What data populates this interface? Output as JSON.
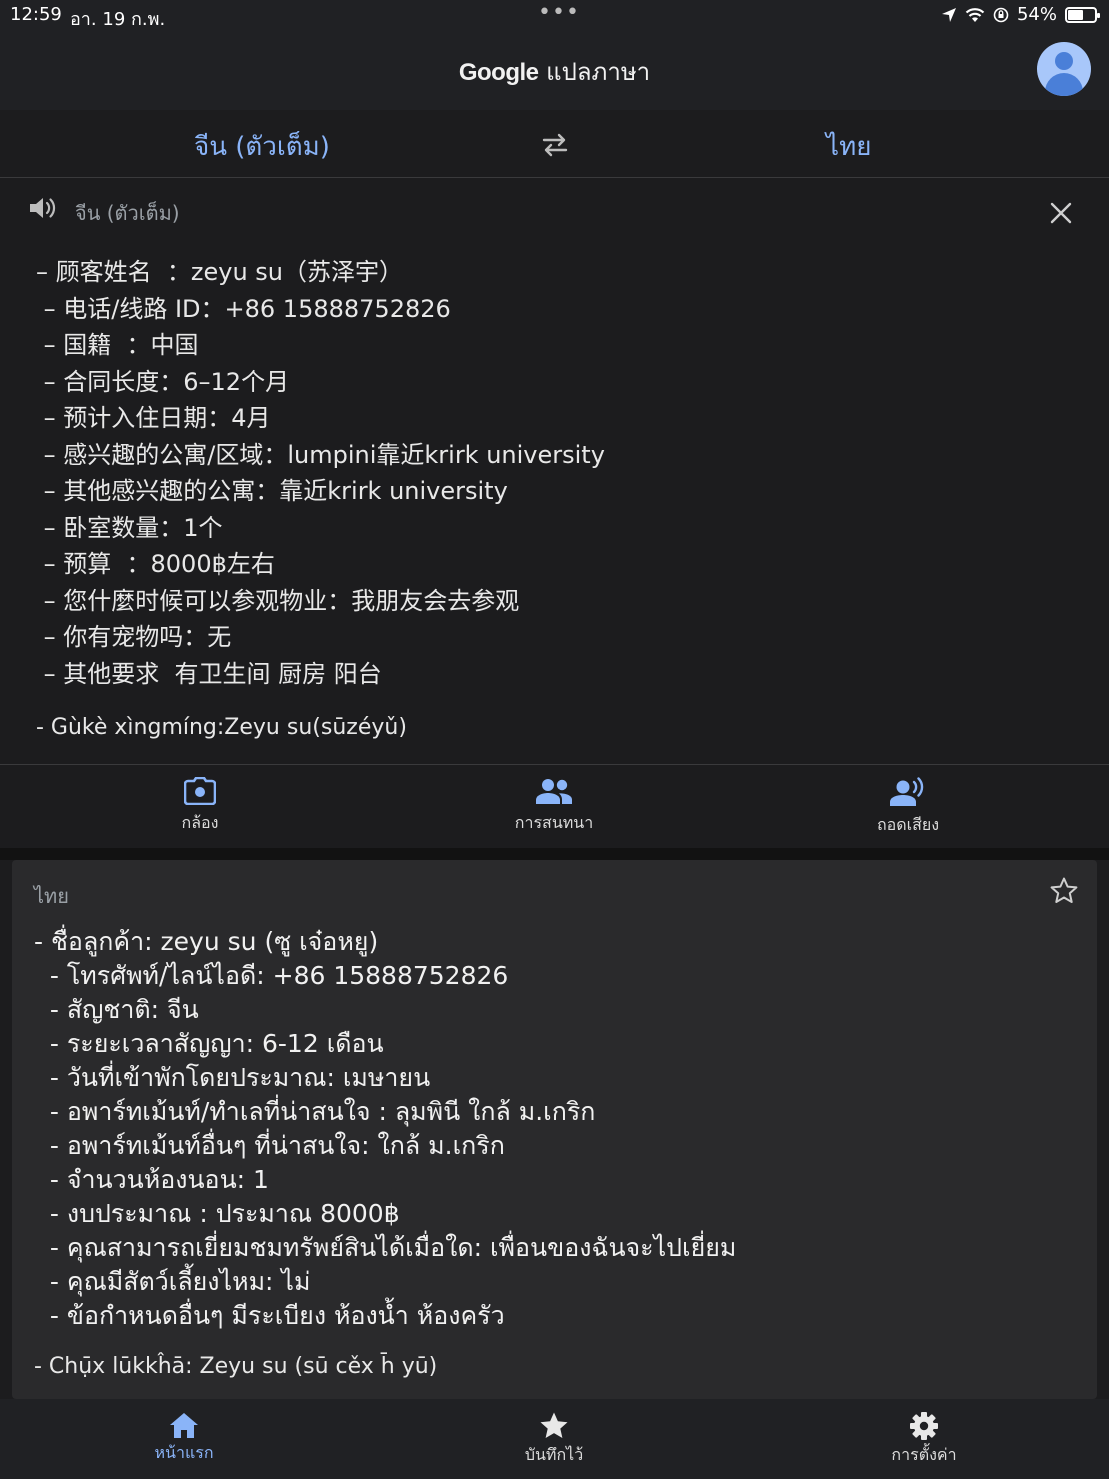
{
  "status": {
    "time": "12:59",
    "date": "อา. 19 ก.พ.",
    "dots": "•••",
    "battery": "54%",
    "battery_level": 0.54
  },
  "header": {
    "brand": "Google",
    "title": "แปลภาษา"
  },
  "languages": {
    "source": "จีน (ตัวเต็ม)",
    "target": "ไทย"
  },
  "source": {
    "lang_label": "จีน (ตัวเต็ม)",
    "text": "– 顾客姓名  ：zeyu su（苏泽宇）\n – 电话/线路 ID：+86 15888752826\n – 国籍  ：中国\n – 合同长度：6–12个月\n – 预计入住日期：4月\n – 感兴趣的公寓/区域：lumpini靠近krirk university\n – 其他感兴趣的公寓：靠近krirk university\n – 卧室数量：1个\n – 预算  ：8000฿左右\n – 您什麼时候可以参观物业：我朋友会去参观\n – 你有宠物吗：无\n – 其他要求  有卫生间 厨房 阳台",
    "romanization": "- Gùkè xìngmíng:Zeyu su(sūzéyǔ)"
  },
  "tools": {
    "camera": "กล้อง",
    "conversation": "การสนทนา",
    "transcribe": "ถอดเสียง"
  },
  "result": {
    "lang_label": "ไทย",
    "text": "- ชื่อลูกค้า: zeyu su (ซู เจ๋อหยู)\n  - โทรศัพท์/ไลน์ไอดี: +86 15888752826\n  - สัญชาติ: จีน\n  - ระยะเวลาสัญญา: 6-12 เดือน\n  - วันที่เข้าพักโดยประมาณ: เมษายน\n  - อพาร์ทเม้นท์/ทำเลที่น่าสนใจ : ลุมพินี ใกล้ ม.เกริก\n  - อพาร์ทเม้นท์อื่นๆ ที่น่าสนใจ: ใกล้ ม.เกริก\n  - จำนวนห้องนอน: 1\n  - งบประมาณ : ประมาณ 8000฿\n  - คุณสามารถเยี่ยมชมทรัพย์สินได้เมื่อใด: เพื่อนของฉันจะไปเยี่ยม\n  - คุณมีสัตว์เลี้ยงไหม: ไม่\n  - ข้อกำหนดอื่นๆ มีระเบียง ห้องน้ำ ห้องครัว",
    "romanization": "- Chụ̄x lūkkĥā: Zeyu su (sū cěx h̄ yū)"
  },
  "nav": {
    "home": "หน้าแรก",
    "saved": "บันทึกไว้",
    "settings": "การตั้งค่า"
  },
  "colors": {
    "accent": "#8ab4f8",
    "background": "#1c1c1e",
    "card": "#2a2a2c"
  }
}
